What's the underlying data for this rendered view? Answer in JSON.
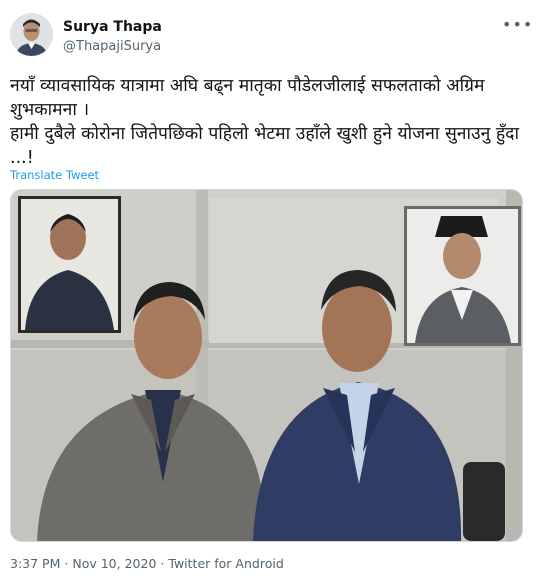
{
  "author": {
    "name": "Surya Thapa",
    "handle": "@ThapajiSurya",
    "avatar_icon": "profile-photo"
  },
  "menu_icon": "more-options-icon",
  "menu_glyph": "•••",
  "tweet": {
    "text": "नयाँ व्यावसायिक यात्रामा अघि बढ्न मातृका पौडेलजीलाई सफलताको अग्रिम शुभकामना ।\nहामी दुबैले कोरोना जितेपछिको पहिलो भेटमा उहाँले खुशी हुने योजना सुनाउनु हुँदा ...!",
    "translate_label": "Translate Tweet"
  },
  "media": {
    "photo_icon": "photo"
  },
  "meta": {
    "time": "3:37 PM",
    "date": "Nov 10, 2020",
    "source": "Twitter for Android",
    "separator": "·"
  },
  "colors": {
    "link": "#1d9bf0",
    "secondary_text": "#536471",
    "primary_text": "#0f1419"
  }
}
